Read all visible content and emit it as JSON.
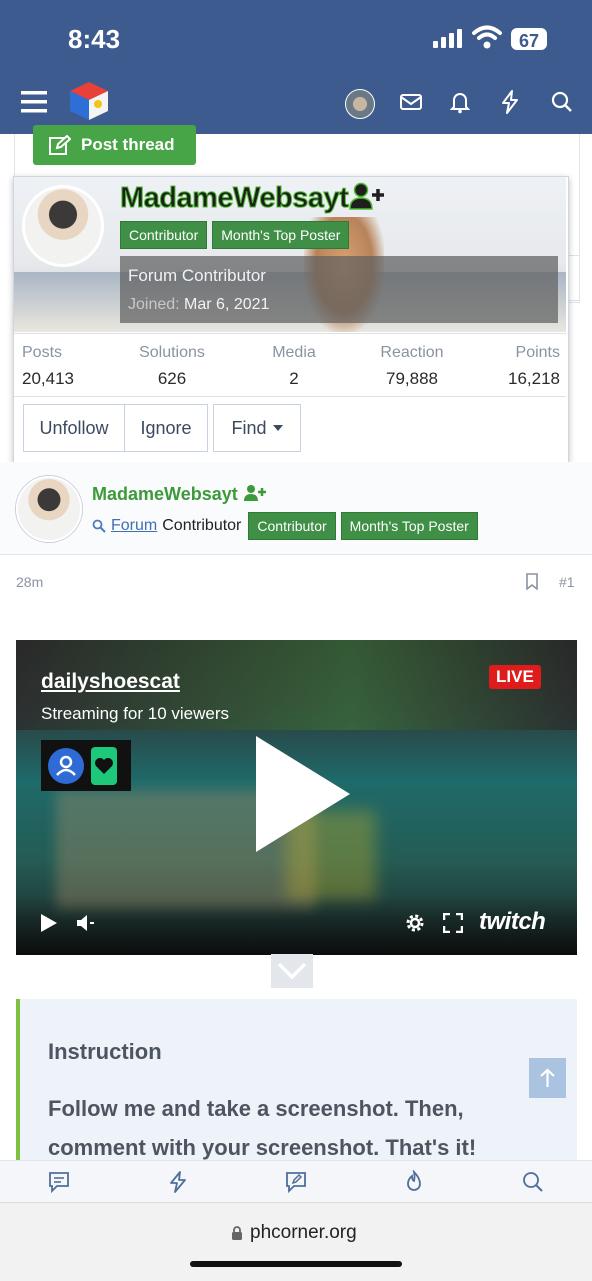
{
  "status": {
    "time": "8:43",
    "battery": "67"
  },
  "header": {
    "icons": [
      "menu-icon",
      "site-logo",
      "avatar",
      "inbox-icon",
      "bell-icon",
      "bolt-icon",
      "search-icon"
    ]
  },
  "page": {
    "post_thread_label": "Post thread"
  },
  "tooltip": {
    "username": "MadameWebsayt",
    "badges": [
      "Contributor",
      "Month's Top Poster"
    ],
    "title": "Forum Contributor",
    "joined_label": "Joined:",
    "joined_date": "Mar 6, 2021",
    "stats": [
      {
        "label": "Posts",
        "value": "20,413"
      },
      {
        "label": "Solutions",
        "value": "626"
      },
      {
        "label": "Media",
        "value": "2"
      },
      {
        "label": "Reaction",
        "value": "79,888"
      },
      {
        "label": "Points",
        "value": "16,218"
      }
    ],
    "buttons": {
      "unfollow": "Unfollow",
      "ignore": "Ignore",
      "find": "Find"
    }
  },
  "poster": {
    "username": "MadameWebsayt",
    "title_link": "Forum",
    "title_rest": "Contributor",
    "badges": [
      "Contributor",
      "Month's Top Poster"
    ],
    "time": "28m",
    "post_number": "#1"
  },
  "video": {
    "channel": "dailyshoescat",
    "subtitle": "Streaming for 10 viewers",
    "live": "LIVE",
    "brand": "twitch"
  },
  "instruction": {
    "heading": "Instruction",
    "body": "Follow me and take a screenshot. Then, comment with your screenshot. That's it!"
  },
  "browser": {
    "url": "phcorner.org"
  }
}
